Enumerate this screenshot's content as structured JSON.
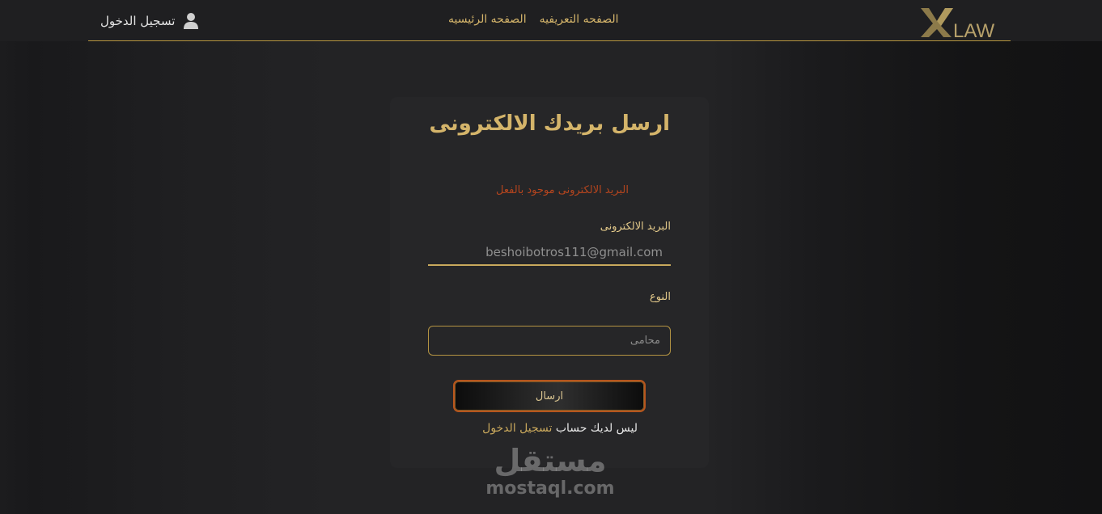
{
  "nav": {
    "login_label": "تسجيل الدخول",
    "links": [
      "الصفحه التعريفيه",
      "الصفحه الرئيسيه"
    ],
    "logo_letter": "X",
    "logo_text": "LAW",
    "accent_color": "#b6953f"
  },
  "form": {
    "title": "ارسل بريدك الالكترونى",
    "error_message": "البريد الالكترونى موجود بالفعل",
    "email_label": "البريد الالكترونى",
    "email_value": "beshoibotros111@gmail.com",
    "type_label": "النوع",
    "type_value": "محامى",
    "submit_label": "ارسال",
    "footer_prefix": "ليس لديك حساب",
    "footer_link": "تسجيل الدخول"
  },
  "watermark": {
    "arabic": "مستقل",
    "latin": "mostaql.com"
  },
  "icons": {
    "user": "user-icon",
    "logo": "xlaw-logo"
  },
  "colors": {
    "gold": "#d4b46a",
    "error": "#b5451e",
    "card_bg": "#262628"
  }
}
